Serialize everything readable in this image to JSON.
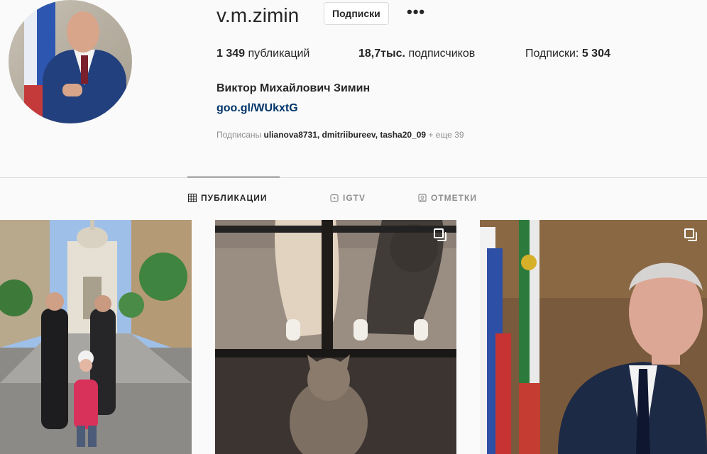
{
  "profile": {
    "username": "v.m.zimin",
    "follow_button": "Подписки",
    "more_icon": "more-horizontal-icon",
    "stats": {
      "posts_count": "1 349",
      "posts_label": "публикаций",
      "followers_count": "18,7тыс.",
      "followers_label": "подписчиков",
      "following_label": "Подписки:",
      "following_count": "5 304"
    },
    "full_name": "Виктор Михайлович Зимин",
    "link": "goo.gl/WUkxtG",
    "followed_by": {
      "prefix": "Подписаны",
      "users": "ulianova8731, dmitriibureev, tasha20_09",
      "suffix": "+ еще 39"
    }
  },
  "tabs": [
    {
      "label": "ПУБЛИКАЦИИ",
      "icon": "grid-icon",
      "active": true
    },
    {
      "label": "IGTV",
      "icon": "igtv-icon",
      "active": false
    },
    {
      "label": "ОТМЕТКИ",
      "icon": "tagged-icon",
      "active": false
    }
  ],
  "posts": [
    {
      "type": "single",
      "subject": "family in front of church on street"
    },
    {
      "type": "carousel",
      "subject": "cats behind glass door"
    },
    {
      "type": "carousel",
      "subject": "man in suit with flags"
    }
  ]
}
